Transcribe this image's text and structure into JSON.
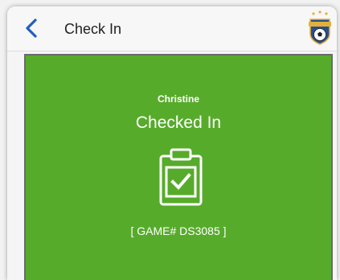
{
  "header": {
    "title": "Check In",
    "back_icon": "chevron-left-icon",
    "logo_icon": "soccer-ball-badge-icon"
  },
  "card": {
    "user_name": "Christine",
    "status": "Checked In",
    "icon": "clipboard-check-icon",
    "game_code": "[ GAME# DS3085 ]"
  },
  "colors": {
    "accent": "#1f5fbf",
    "card_background": "#57ab2b",
    "card_text": "#ffffff"
  }
}
